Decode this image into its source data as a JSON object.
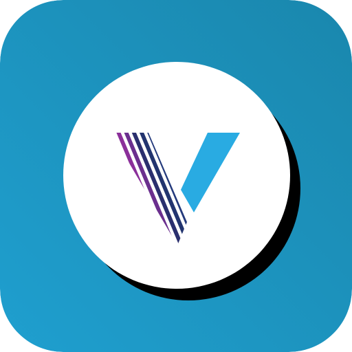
{
  "app_icon": {
    "icon": "v-logo-icon",
    "description_visible_text": "",
    "colors": {
      "background_start": "#1f9fcf",
      "background_end": "#1a87ad",
      "disc": "#ffffff",
      "disc_shadow": "#000000",
      "right_arm": "#29abe2",
      "stripes": [
        "#8b2f9a",
        "#6b2f8e",
        "#2a2f6e",
        "#22346f",
        "#243a7c",
        "#27549e",
        "#2b74c1",
        "#29a3e1",
        "#3bc3ea",
        "#2fb57a"
      ]
    }
  }
}
